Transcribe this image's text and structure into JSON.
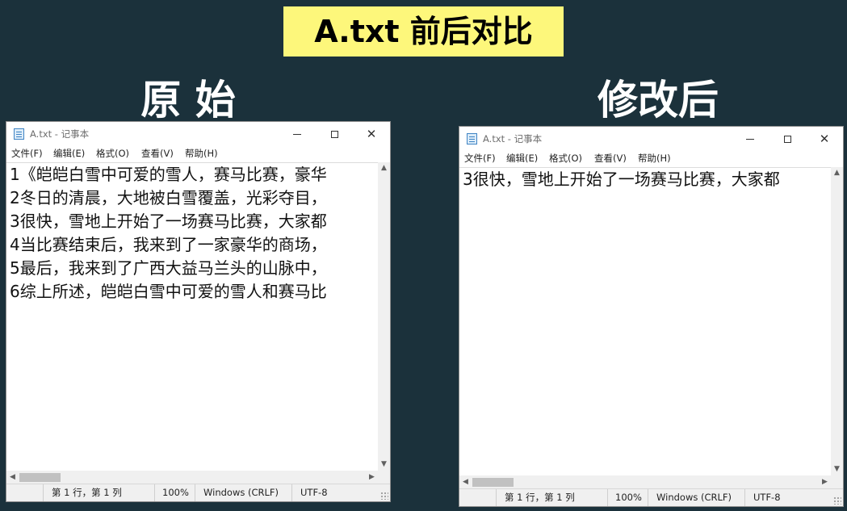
{
  "banner": "A.txt 前后对比",
  "labels": {
    "left": "原 始",
    "right": "修改后"
  },
  "window_title": "A.txt - 记事本",
  "menu": [
    "文件(F)",
    "编辑(E)",
    "格式(O)",
    "查看(V)",
    "帮助(H)"
  ],
  "original_lines": [
    "1《皑皑白雪中可爱的雪人，赛马比赛，豪华",
    "2冬日的清晨，大地被白雪覆盖，光彩夺目，",
    "3很快，雪地上开始了一场赛马比赛，大家都",
    "4当比赛结束后，我来到了一家豪华的商场，",
    "5最后，我来到了广西大益马兰头的山脉中，",
    "6综上所述，皑皑白雪中可爱的雪人和赛马比"
  ],
  "modified_lines": [
    "3很快，雪地上开始了一场赛马比赛，大家都"
  ],
  "status": {
    "position": "第 1 行，第 1 列",
    "zoom": "100%",
    "line_ending": "Windows (CRLF)",
    "encoding": "UTF-8"
  },
  "colors": {
    "background": "#1b313b",
    "banner": "#fdf77b"
  },
  "icons": [
    "notepad-icon",
    "minimize-icon",
    "maximize-icon",
    "close-icon",
    "resize-grip-icon"
  ]
}
